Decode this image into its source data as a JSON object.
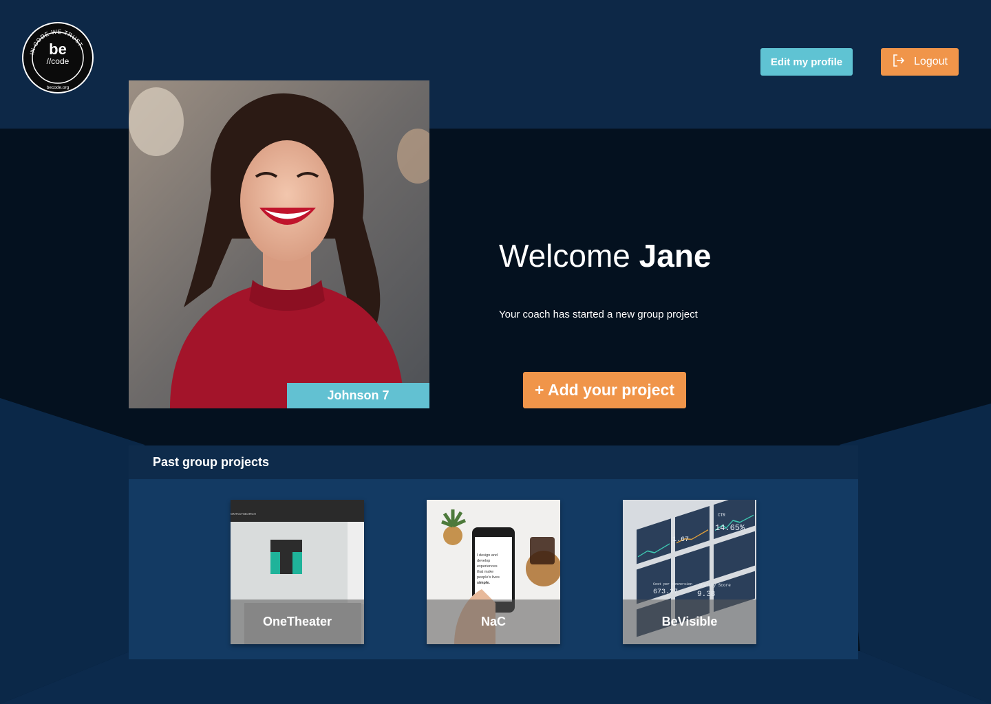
{
  "header": {
    "logo": {
      "ring_text": "IN CODE WE TRUST",
      "wordmark_top": "be",
      "wordmark_bottom": "//code",
      "site": "becode.org"
    },
    "edit_profile_label": "Edit my profile",
    "logout_label": "Logout",
    "logout_icon": "logout-icon"
  },
  "profile": {
    "cohort": "Johnson 7"
  },
  "welcome": {
    "greeting": "Welcome",
    "name": "Jane",
    "message": "Your coach has started a new group project",
    "add_project_label": "+ Add your project"
  },
  "past_projects": {
    "title": "Past group projects",
    "items": [
      {
        "name": "OneTheater",
        "thumbnail_text": [
          "ONTACT",
          "SEARCH"
        ]
      },
      {
        "name": "NaC",
        "thumbnail_text": [
          "I design and",
          "develop",
          "experiences",
          "that make",
          "people's lives",
          "simple."
        ]
      },
      {
        "name": "BeVisible",
        "thumbnail_text": [
          "CTR",
          "14.65%",
          "1.67",
          "Cost per conversion",
          "673.27",
          "Quality Score",
          "9.38"
        ]
      }
    ]
  },
  "colors": {
    "header_bg": "#0d2847",
    "hero_bg": "#04111f",
    "accent_teal": "#5fc3d3",
    "accent_orange": "#f0954a",
    "panel_bg": "#133a63",
    "panel_header_bg": "#0e2b4b"
  }
}
